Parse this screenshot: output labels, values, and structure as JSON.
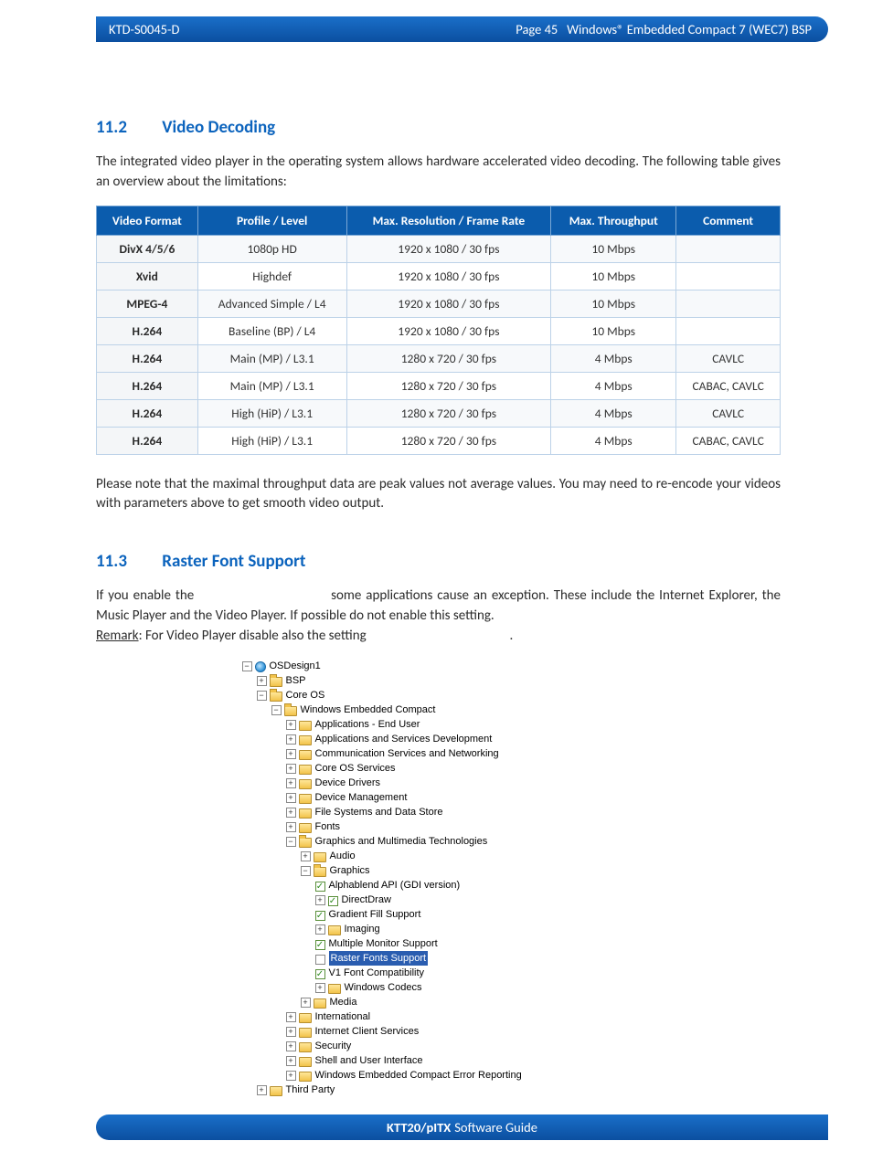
{
  "header": {
    "doc_id": "KTD-S0045-D",
    "page_label": "Page 45",
    "title": "Windows® Embedded Compact 7 (WEC7) BSP"
  },
  "section1": {
    "number": "11.2",
    "title": "Video Decoding",
    "intro": "The integrated video player in the operating system allows hardware accelerated video decoding. The following table gives an overview about the limitations:",
    "note": "Please note that the maximal throughput data are peak values not average values. You may need to re-encode your videos with parameters above to get smooth video output.",
    "table": {
      "headers": [
        "Video Format",
        "Profile / Level",
        "Max. Resolution / Frame Rate",
        "Max. Throughput",
        "Comment"
      ],
      "rows": [
        [
          "DivX 4/5/6",
          "1080p HD",
          "1920 x 1080 / 30 fps",
          "10 Mbps",
          ""
        ],
        [
          "Xvid",
          "Highdef",
          "1920 x 1080 / 30 fps",
          "10 Mbps",
          ""
        ],
        [
          "MPEG-4",
          "Advanced Simple / L4",
          "1920 x 1080 / 30 fps",
          "10 Mbps",
          ""
        ],
        [
          "H.264",
          "Baseline (BP) / L4",
          "1920 x 1080 / 30 fps",
          "10 Mbps",
          ""
        ],
        [
          "H.264",
          "Main (MP) / L3.1",
          "1280 x 720 / 30 fps",
          "4 Mbps",
          "CAVLC"
        ],
        [
          "H.264",
          "Main (MP) / L3.1",
          "1280 x 720 / 30 fps",
          "4 Mbps",
          "CABAC, CAVLC"
        ],
        [
          "H.264",
          "High (HiP) / L3.1",
          "1280 x 720 / 30 fps",
          "4 Mbps",
          "CAVLC"
        ],
        [
          "H.264",
          "High (HiP) / L3.1",
          "1280 x 720 / 30 fps",
          "4 Mbps",
          "CABAC, CAVLC"
        ]
      ]
    }
  },
  "section2": {
    "number": "11.3",
    "title": "Raster Font Support",
    "para_pre": "If you enable the ",
    "para_mid": " some applications cause an exception. These include the Internet Explorer, the Music Player and the Video Player. If possible do not enable this setting.",
    "remark_label": "Remark",
    "remark_text": ": For Video Player disable also the setting ",
    "remark_tail": "."
  },
  "tree": {
    "root": "OSDesign1",
    "items": [
      "BSP",
      "Core OS",
      "Windows Embedded Compact",
      "Applications - End User",
      "Applications and Services Development",
      "Communication Services and Networking",
      "Core OS Services",
      "Device Drivers",
      "Device Management",
      "File Systems and Data Store",
      "Fonts",
      "Graphics and Multimedia Technologies",
      "Audio",
      "Graphics",
      "Alphablend API (GDI version)",
      "DirectDraw",
      "Gradient Fill Support",
      "Imaging",
      "Multiple Monitor Support",
      "Raster Fonts Support",
      "V1 Font Compatibility",
      "Windows Codecs",
      "Media",
      "International",
      "Internet Client Services",
      "Security",
      "Shell and User Interface",
      "Windows Embedded Compact Error Reporting",
      "Third Party"
    ]
  },
  "footer": {
    "bold": "KTT20/pITX",
    "rest": "Software Guide"
  }
}
